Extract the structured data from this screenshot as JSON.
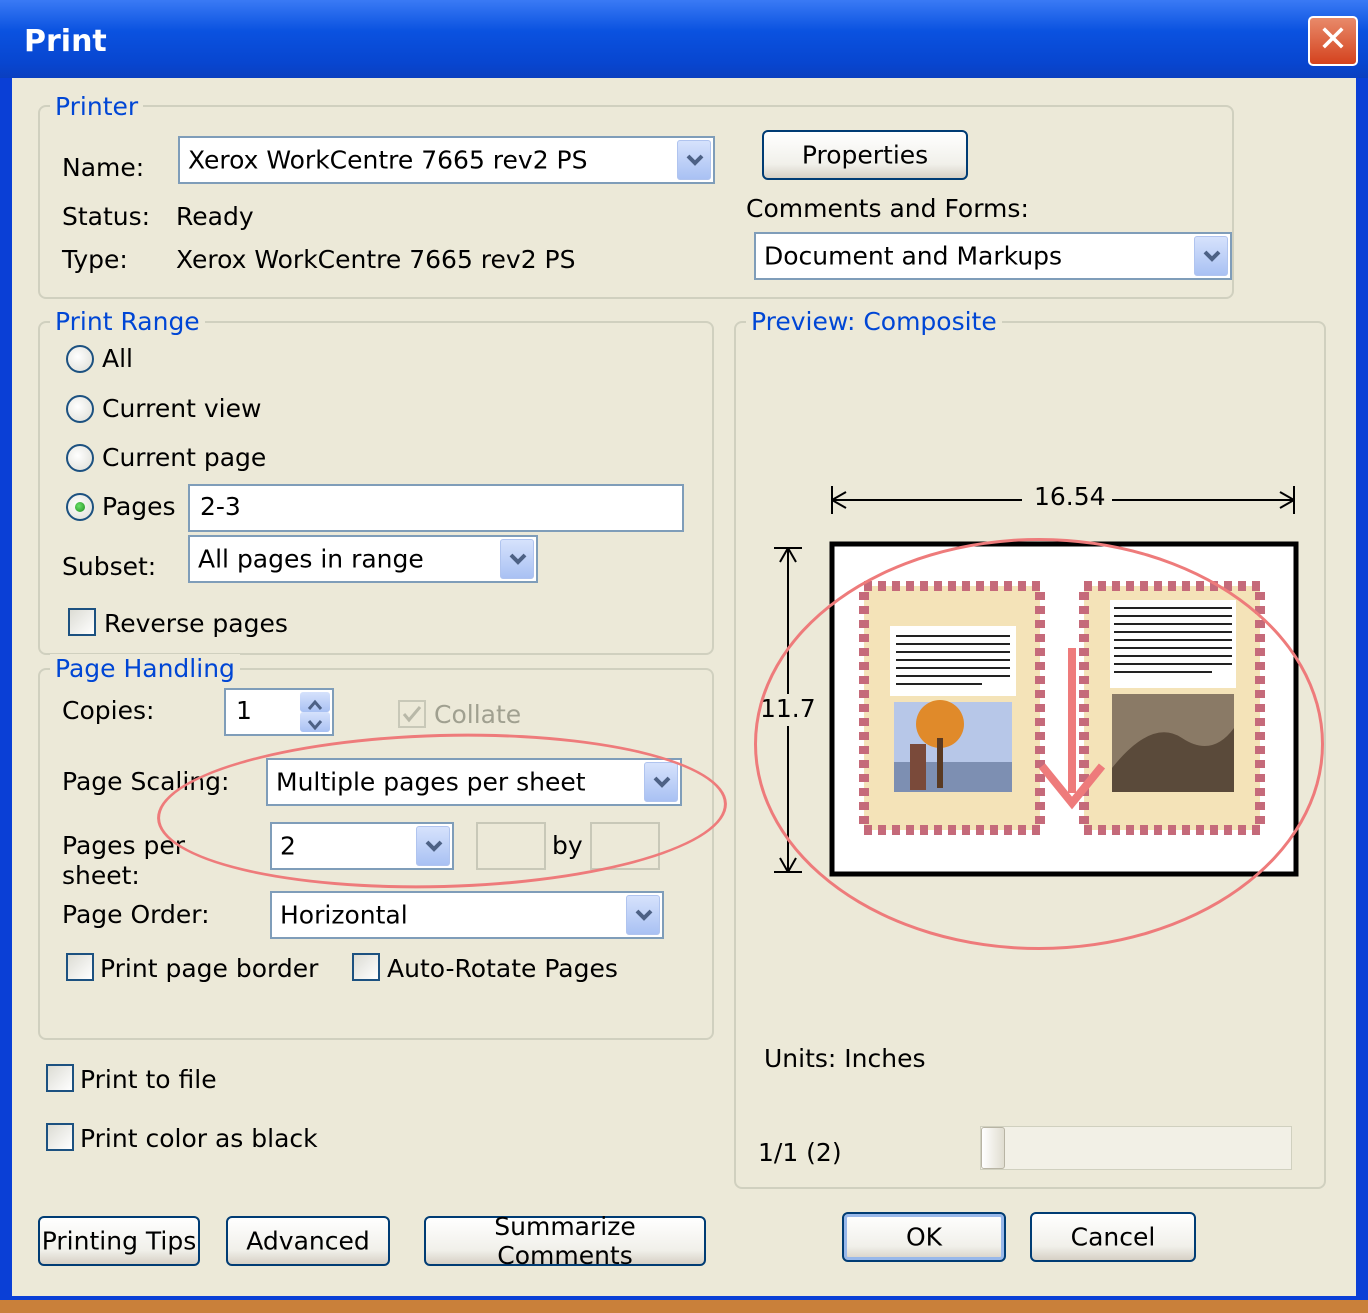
{
  "window": {
    "title": "Print"
  },
  "printer": {
    "group_label": "Printer",
    "name_label": "Name:",
    "name_value": "Xerox WorkCentre 7665 rev2 PS",
    "status_label": "Status:",
    "status_value": "Ready",
    "type_label": "Type:",
    "type_value": "Xerox WorkCentre 7665 rev2 PS",
    "properties_label": "Properties",
    "comments_label": "Comments and Forms:",
    "comments_value": "Document and Markups"
  },
  "print_range": {
    "group_label": "Print Range",
    "all_label": "All",
    "current_view_label": "Current view",
    "current_page_label": "Current page",
    "pages_label": "Pages",
    "pages_value": "2-3",
    "selected": "pages",
    "subset_label": "Subset:",
    "subset_value": "All pages in range",
    "reverse_label": "Reverse pages"
  },
  "page_handling": {
    "group_label": "Page Handling",
    "copies_label": "Copies:",
    "copies_value": "1",
    "collate_label": "Collate",
    "scaling_label": "Page Scaling:",
    "scaling_value": "Multiple pages per sheet",
    "pps_label_1": "Pages per",
    "pps_label_2": "sheet:",
    "pps_value": "2",
    "by_label": "by",
    "order_label": "Page Order:",
    "order_value": "Horizontal",
    "border_label": "Print page border",
    "autorotate_label": "Auto-Rotate Pages"
  },
  "options": {
    "print_to_file_label": "Print to file",
    "color_black_label": "Print color as black"
  },
  "preview": {
    "group_label": "Preview: Composite",
    "width_value": "16.54",
    "height_value": "11.7",
    "units_label": "Units: Inches",
    "page_indicator": "1/1 (2)"
  },
  "buttons": {
    "tips": "Printing Tips",
    "advanced": "Advanced",
    "summarize": "Summarize Comments",
    "ok": "OK",
    "cancel": "Cancel"
  },
  "colors": {
    "annotation": "#ee7b7b",
    "group_label": "#0046d5",
    "title_bar": "#0a52e0"
  }
}
